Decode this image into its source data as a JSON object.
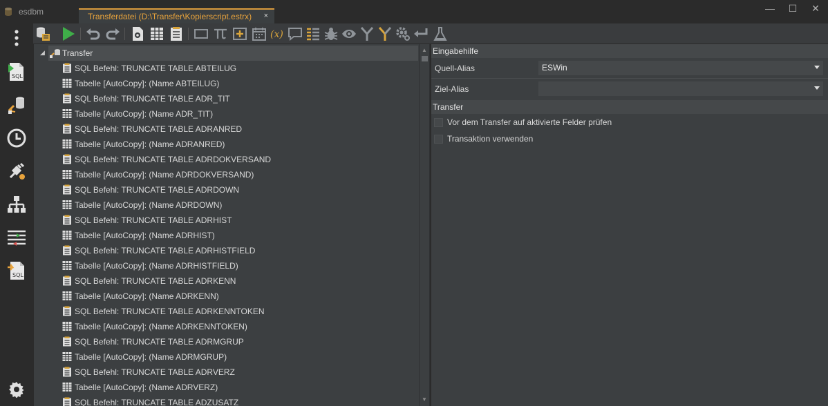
{
  "app": {
    "title": "esdbm"
  },
  "tab": {
    "label": "Transferdatei (D:\\Transfer\\Kopierscript.estrx)",
    "close": "×"
  },
  "window_controls": {
    "minimize": "—",
    "maximize": "☐",
    "close": "✕"
  },
  "sidebar": {
    "items": [
      {
        "name": "more-icon"
      },
      {
        "name": "sql-editor-icon",
        "text": "SQL"
      },
      {
        "name": "data-transfer-icon"
      },
      {
        "name": "history-icon"
      },
      {
        "name": "connections-icon"
      },
      {
        "name": "structure-icon"
      },
      {
        "name": "compare-icon"
      },
      {
        "name": "sql-script-icon",
        "text": "SQL"
      },
      {
        "name": "settings-icon"
      }
    ]
  },
  "toolbar": {
    "icons": [
      "database-add-icon",
      "run-icon",
      "undo-icon",
      "redo-icon",
      "script-settings-icon",
      "table-icon",
      "sql-list-icon",
      "frame-icon",
      "pi-icon",
      "add-box-icon",
      "calendar-icon",
      "variable-icon",
      "comment-icon",
      "list-icon",
      "bug-icon",
      "eye-icon",
      "merge-icon",
      "split-icon",
      "gear-config-icon",
      "return-icon",
      "flask-icon"
    ]
  },
  "tree": {
    "root": {
      "label": "Transfer",
      "expander": "◢"
    },
    "items": [
      {
        "type": "sql",
        "label": "SQL Befehl: TRUNCATE TABLE ABTEILUG"
      },
      {
        "type": "table",
        "label": "Tabelle [AutoCopy]: (Name ABTEILUG)"
      },
      {
        "type": "sql",
        "label": "SQL Befehl: TRUNCATE TABLE ADR_TIT"
      },
      {
        "type": "table",
        "label": "Tabelle [AutoCopy]: (Name ADR_TIT)"
      },
      {
        "type": "sql",
        "label": "SQL Befehl: TRUNCATE TABLE ADRANRED"
      },
      {
        "type": "table",
        "label": "Tabelle [AutoCopy]: (Name ADRANRED)"
      },
      {
        "type": "sql",
        "label": "SQL Befehl: TRUNCATE TABLE ADRDOKVERSAND"
      },
      {
        "type": "table",
        "label": "Tabelle [AutoCopy]: (Name ADRDOKVERSAND)"
      },
      {
        "type": "sql",
        "label": "SQL Befehl: TRUNCATE TABLE ADRDOWN"
      },
      {
        "type": "table",
        "label": "Tabelle [AutoCopy]: (Name ADRDOWN)"
      },
      {
        "type": "sql",
        "label": "SQL Befehl: TRUNCATE TABLE ADRHIST"
      },
      {
        "type": "table",
        "label": "Tabelle [AutoCopy]: (Name ADRHIST)"
      },
      {
        "type": "sql",
        "label": "SQL Befehl: TRUNCATE TABLE ADRHISTFIELD"
      },
      {
        "type": "table",
        "label": "Tabelle [AutoCopy]: (Name ADRHISTFIELD)"
      },
      {
        "type": "sql",
        "label": "SQL Befehl: TRUNCATE TABLE ADRKENN"
      },
      {
        "type": "table",
        "label": "Tabelle [AutoCopy]: (Name ADRKENN)"
      },
      {
        "type": "sql",
        "label": "SQL Befehl: TRUNCATE TABLE ADRKENNTOKEN"
      },
      {
        "type": "table",
        "label": "Tabelle [AutoCopy]: (Name ADRKENNTOKEN)"
      },
      {
        "type": "sql",
        "label": "SQL Befehl: TRUNCATE TABLE ADRMGRUP"
      },
      {
        "type": "table",
        "label": "Tabelle [AutoCopy]: (Name ADRMGRUP)"
      },
      {
        "type": "sql",
        "label": "SQL Befehl: TRUNCATE TABLE ADRVERZ"
      },
      {
        "type": "table",
        "label": "Tabelle [AutoCopy]: (Name ADRVERZ)"
      },
      {
        "type": "sql",
        "label": "SQL Befehl: TRUNCATE TABLE ADZUSATZ"
      }
    ]
  },
  "properties": {
    "section_eingabehilfe": "Eingabehilfe",
    "quell_alias_label": "Quell-Alias",
    "quell_alias_value": "ESWin",
    "ziel_alias_label": "Ziel-Alias",
    "ziel_alias_value": "",
    "section_transfer": "Transfer",
    "check_fields_label": "Vor dem Transfer auf aktivierte Felder prüfen",
    "check_fields_checked": false,
    "use_transaction_label": "Transaktion verwenden",
    "use_transaction_checked": false
  },
  "colors": {
    "accent": "#e8a33c",
    "background": "#2b2b2b",
    "panel": "#3c3f41",
    "run_green": "#3fae49"
  }
}
